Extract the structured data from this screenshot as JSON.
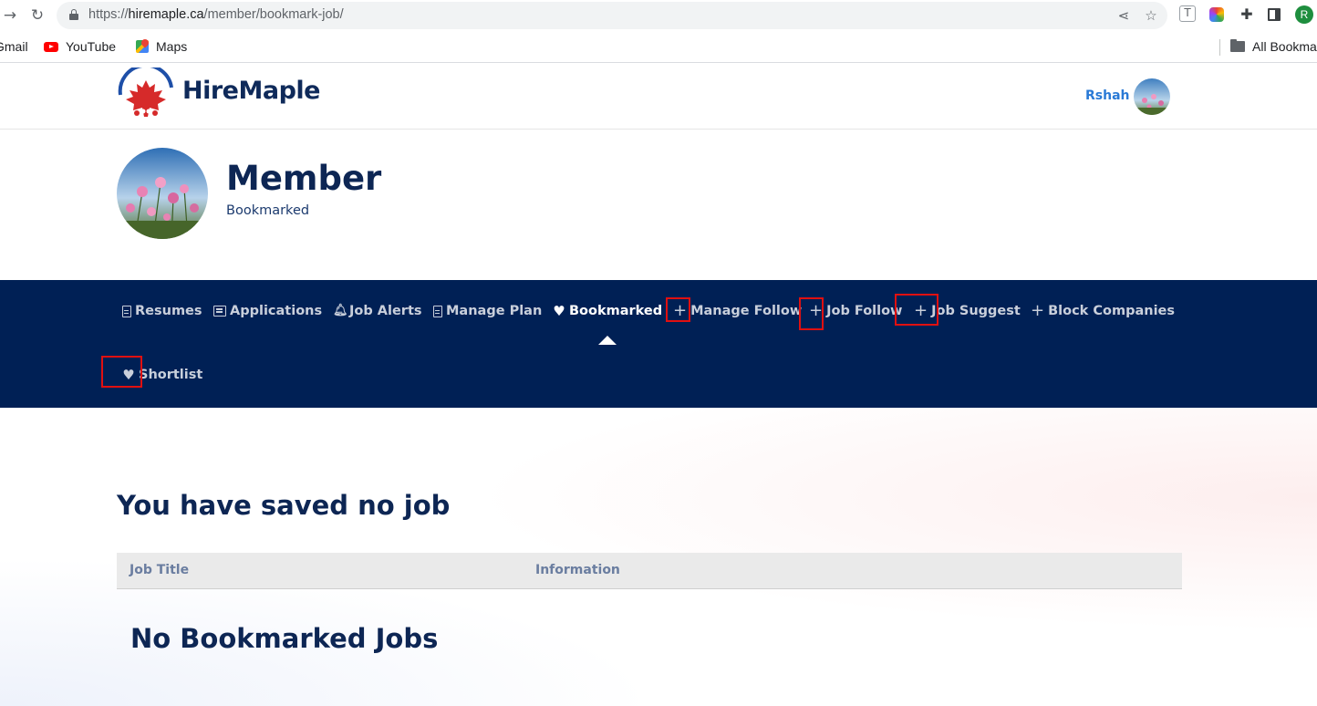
{
  "browser": {
    "url_scheme": "https://",
    "url_host": "hiremaple.ca",
    "url_path": "/member/bookmark-job/",
    "profile_initial": "R",
    "bookmarks": [
      {
        "label": "Gmail"
      },
      {
        "label": "YouTube"
      },
      {
        "label": "Maps"
      }
    ],
    "all_bookmarks": "All Bookmarks"
  },
  "site": {
    "brand": "HireMaple",
    "user_name": "Rshah"
  },
  "member": {
    "title": "Member",
    "subtitle": "Bookmarked"
  },
  "nav": {
    "items": [
      {
        "label": "Resumes",
        "icon": "file-icon"
      },
      {
        "label": "Applications",
        "icon": "list-icon"
      },
      {
        "label": "Job Alerts",
        "icon": "bell-icon"
      },
      {
        "label": "Manage Plan",
        "icon": "file-icon"
      },
      {
        "label": "Bookmarked",
        "icon": "heart-icon",
        "active": true
      },
      {
        "label": "Manage Follow",
        "icon": "plus-icon"
      },
      {
        "label": "Job Follow",
        "icon": "plus-icon"
      },
      {
        "label": "Job Suggest",
        "icon": "plus-icon"
      },
      {
        "label": "Block Companies",
        "icon": "plus-icon"
      },
      {
        "label": "Shortlist",
        "icon": "heart-icon"
      }
    ],
    "highlight_color": "#e01010",
    "background": "#002055"
  },
  "content": {
    "heading": "You have saved no job",
    "table_headers": [
      "Job Title",
      "Information"
    ],
    "empty_message": "No Bookmarked Jobs"
  }
}
